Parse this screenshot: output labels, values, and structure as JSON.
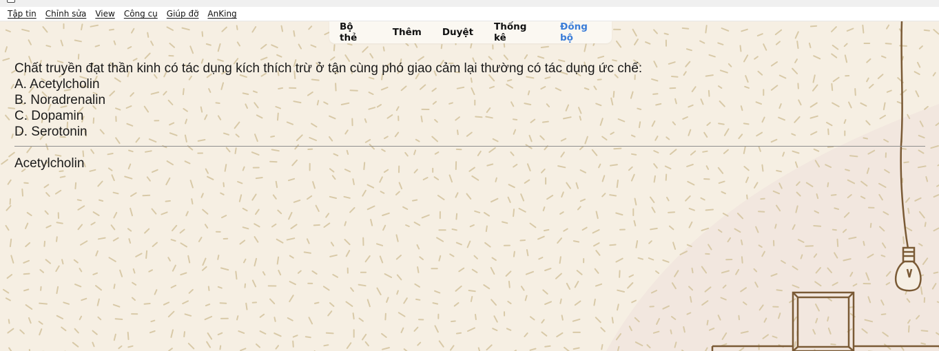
{
  "menu": {
    "items": [
      {
        "label": "Tập tin"
      },
      {
        "label": "Chỉnh sửa"
      },
      {
        "label": "View"
      },
      {
        "label": "Công cụ"
      },
      {
        "label": "Giúp đỡ"
      },
      {
        "label": "AnKing"
      }
    ]
  },
  "toolbar": {
    "decks": "Bộ thẻ",
    "add": "Thêm",
    "browse": "Duyệt",
    "stats": "Thống kê",
    "sync": "Đồng bộ",
    "sync_color": "#3b7dd8"
  },
  "card": {
    "question": "Chất truyền đạt thần kinh có tác dụng kích thích trừ ở tận cùng phó giao cảm lại thường có tác dụng ức chế:",
    "options": [
      "A. Acetylcholin",
      "B. Noradrenalin",
      "C. Dopamin",
      "D. Serotonin"
    ],
    "answer": "Acetylcholin"
  },
  "colors": {
    "background": "#f6efe3",
    "pattern": "#d8c9a7",
    "illustration": "#7a5a35"
  }
}
